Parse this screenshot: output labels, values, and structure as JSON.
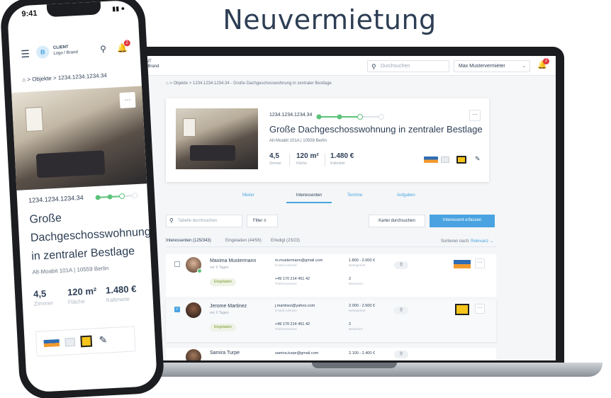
{
  "headline": "Neuvermietung",
  "laptop": {
    "brand": {
      "line1": "IENT",
      "line2": "o / Brand"
    },
    "search_placeholder": "Durchsuchen",
    "user": "Max Mustervermieter",
    "notifications": "2",
    "breadcrumb": "⌂ > Objekte > 1234.1234.1234.34 - Große Dachgeschosswohnung in zentraler Bestlage",
    "property": {
      "id": "1234.1234.1234.34",
      "title": "Große Dachgeschosswohnung in zentraler Bestlage",
      "address": "Alt-Moabit 101A | 10559 Berlin",
      "rooms": {
        "value": "4,5",
        "label": "Zimmer"
      },
      "area": {
        "value": "120 m²",
        "label": "Fläche"
      },
      "rent": {
        "value": "1.480 €",
        "label": "Kaltmiete"
      }
    },
    "tabs": [
      "Mieter",
      "Interessenten",
      "Termine",
      "Aufgaben"
    ],
    "list": {
      "search_placeholder": "Tabelle durchsuchen",
      "filter": "Filter",
      "kartei": "Kartei durchsuchen",
      "add": "Interessent erfassen"
    },
    "subtabs": [
      "Interessenten (125/343)",
      "Eingeladen (44/56)",
      "Erledigt (23/23)"
    ],
    "sort_label": "Sortieren nach:",
    "sort_value": "Relevanz",
    "rows": [
      {
        "name": "Maxima Mustermann",
        "since": "vor X Tagen",
        "status": "Eingeladen",
        "email": "m.mustermann@gmail.com",
        "email_label": "E-Mail-Adresse",
        "phone": "+49 170 214 451 42",
        "phone_label": "Telefonnummer",
        "income": "1.800 - 2.000 €",
        "income_label": "Nettogehalt",
        "persons": "2",
        "persons_label": "Bewohner",
        "checked": false
      },
      {
        "name": "Jerome Martinez",
        "since": "vor X Tagen",
        "status": "Eingeladen",
        "email": "j.martinez@yahoo.com",
        "email_label": "E-Mail-Adresse",
        "phone": "+49 170 214 451 42",
        "phone_label": "Telefonnummer",
        "income": "2.000 - 2.500 €",
        "income_label": "Nettogehalt",
        "persons": "2",
        "persons_label": "Bewohner",
        "checked": true
      },
      {
        "name": "Samira Turpe",
        "since": "",
        "status": "",
        "email": "samira.turpe@gmail.com",
        "email_label": "",
        "phone": "",
        "phone_label": "",
        "income": "2.100 - 2.400 €",
        "income_label": "",
        "persons": "",
        "persons_label": "",
        "checked": false
      }
    ],
    "colors": {
      "accent": "#4aa3e0",
      "progress": "#5cc27a",
      "text": "#2d3e54"
    }
  },
  "phone": {
    "time": "9:41",
    "brand_logo": "B",
    "client_line1": "CLIENT",
    "client_line2": "Logo / Brand",
    "notifications": "2",
    "breadcrumb": "⌂ > Objekte > 1234.1234.1234.34",
    "id": "1234.1234.1234.34",
    "title": "Große Dachgeschosswohnung in zentraler Bestlage",
    "address": "Alt-Moabit 101A | 10559 Berlin",
    "rooms": {
      "value": "4,5",
      "label": "Zimmer"
    },
    "area": {
      "value": "120 m²",
      "label": "Fläche"
    },
    "rent": {
      "value": "1.480 €",
      "label": "Kaltmiete"
    }
  },
  "icons": {
    "search": "search-icon",
    "bell": "bell-icon",
    "menu": "hamburger-menu-icon",
    "pencil": "pencil-icon",
    "more": "more-dots-icon",
    "chevron": "chevron-down-icon"
  }
}
